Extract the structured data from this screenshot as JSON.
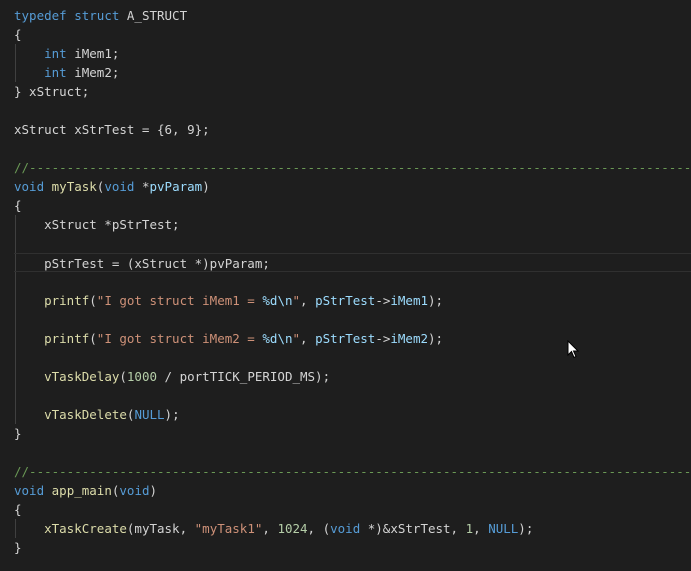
{
  "editor": {
    "colors": {
      "background": "#1e1e1e",
      "keyword": "#569cd6",
      "function": "#dcdcaa",
      "string": "#ce9178",
      "parameter": "#9cdcfe",
      "number": "#b5cea8",
      "comment": "#6a9955",
      "format_specifier": "#9cdcfe",
      "text": "#d4d4d4"
    },
    "lines": [
      [
        {
          "t": "typedef",
          "c": "keyword"
        },
        {
          "t": " "
        },
        {
          "t": "struct",
          "c": "keyword"
        },
        {
          "t": " A_STRUCT"
        }
      ],
      [
        {
          "t": "{"
        }
      ],
      [
        {
          "t": "    "
        },
        {
          "t": "int",
          "c": "keyword"
        },
        {
          "t": " iMem1;"
        }
      ],
      [
        {
          "t": "    "
        },
        {
          "t": "int",
          "c": "keyword"
        },
        {
          "t": " iMem2;"
        }
      ],
      [
        {
          "t": "} xStruct;"
        }
      ],
      [],
      [
        {
          "t": "xStruct xStrTest = {6, 9};"
        }
      ],
      [],
      [
        {
          "t": "//-----------------------------------------------------------------------------------------",
          "c": "comment"
        }
      ],
      [
        {
          "t": "void",
          "c": "keyword"
        },
        {
          "t": " "
        },
        {
          "t": "myTask",
          "c": "function"
        },
        {
          "t": "("
        },
        {
          "t": "void",
          "c": "keyword"
        },
        {
          "t": " *"
        },
        {
          "t": "pvParam",
          "c": "parameter"
        },
        {
          "t": ")"
        }
      ],
      [
        {
          "t": "{"
        }
      ],
      [
        {
          "t": "    xStruct *pStrTest;"
        }
      ],
      [],
      [
        {
          "t": "    pStrTest = (xStruct *)pvParam;"
        }
      ],
      [],
      [
        {
          "t": "    "
        },
        {
          "t": "printf",
          "c": "function"
        },
        {
          "t": "("
        },
        {
          "t": "\"I got struct iMem1 = ",
          "c": "string"
        },
        {
          "t": "%d",
          "c": "format_specifier"
        },
        {
          "t": "\\n",
          "c": "format_specifier"
        },
        {
          "t": "\"",
          "c": "string"
        },
        {
          "t": ", "
        },
        {
          "t": "pStrTest",
          "c": "parameter"
        },
        {
          "t": "->"
        },
        {
          "t": "iMem1",
          "c": "parameter"
        },
        {
          "t": ");"
        }
      ],
      [],
      [
        {
          "t": "    "
        },
        {
          "t": "printf",
          "c": "function"
        },
        {
          "t": "("
        },
        {
          "t": "\"I got struct iMem2 = ",
          "c": "string"
        },
        {
          "t": "%d",
          "c": "format_specifier"
        },
        {
          "t": "\\n",
          "c": "format_specifier"
        },
        {
          "t": "\"",
          "c": "string"
        },
        {
          "t": ", "
        },
        {
          "t": "pStrTest",
          "c": "parameter"
        },
        {
          "t": "->"
        },
        {
          "t": "iMem2",
          "c": "parameter"
        },
        {
          "t": ");"
        }
      ],
      [],
      [
        {
          "t": "    "
        },
        {
          "t": "vTaskDelay",
          "c": "function"
        },
        {
          "t": "("
        },
        {
          "t": "1000",
          "c": "number"
        },
        {
          "t": " / portTICK_PERIOD_MS);"
        }
      ],
      [],
      [
        {
          "t": "    "
        },
        {
          "t": "vTaskDelete",
          "c": "function"
        },
        {
          "t": "("
        },
        {
          "t": "NULL",
          "c": "keyword"
        },
        {
          "t": ");"
        }
      ],
      [
        {
          "t": "}"
        }
      ],
      [],
      [
        {
          "t": "//-----------------------------------------------------------------------------------------",
          "c": "comment"
        }
      ],
      [
        {
          "t": "void",
          "c": "keyword"
        },
        {
          "t": " "
        },
        {
          "t": "app_main",
          "c": "function"
        },
        {
          "t": "("
        },
        {
          "t": "void",
          "c": "keyword"
        },
        {
          "t": ")"
        }
      ],
      [
        {
          "t": "{"
        }
      ],
      [
        {
          "t": "    "
        },
        {
          "t": "xTaskCreate",
          "c": "function"
        },
        {
          "t": "(myTask, "
        },
        {
          "t": "\"myTask1\"",
          "c": "string"
        },
        {
          "t": ", "
        },
        {
          "t": "1024",
          "c": "number"
        },
        {
          "t": ", ("
        },
        {
          "t": "void",
          "c": "keyword"
        },
        {
          "t": " *)&xStrTest, "
        },
        {
          "t": "1",
          "c": "number"
        },
        {
          "t": ", "
        },
        {
          "t": "NULL",
          "c": "keyword"
        },
        {
          "t": ");"
        }
      ],
      [
        {
          "t": "}"
        }
      ]
    ]
  }
}
